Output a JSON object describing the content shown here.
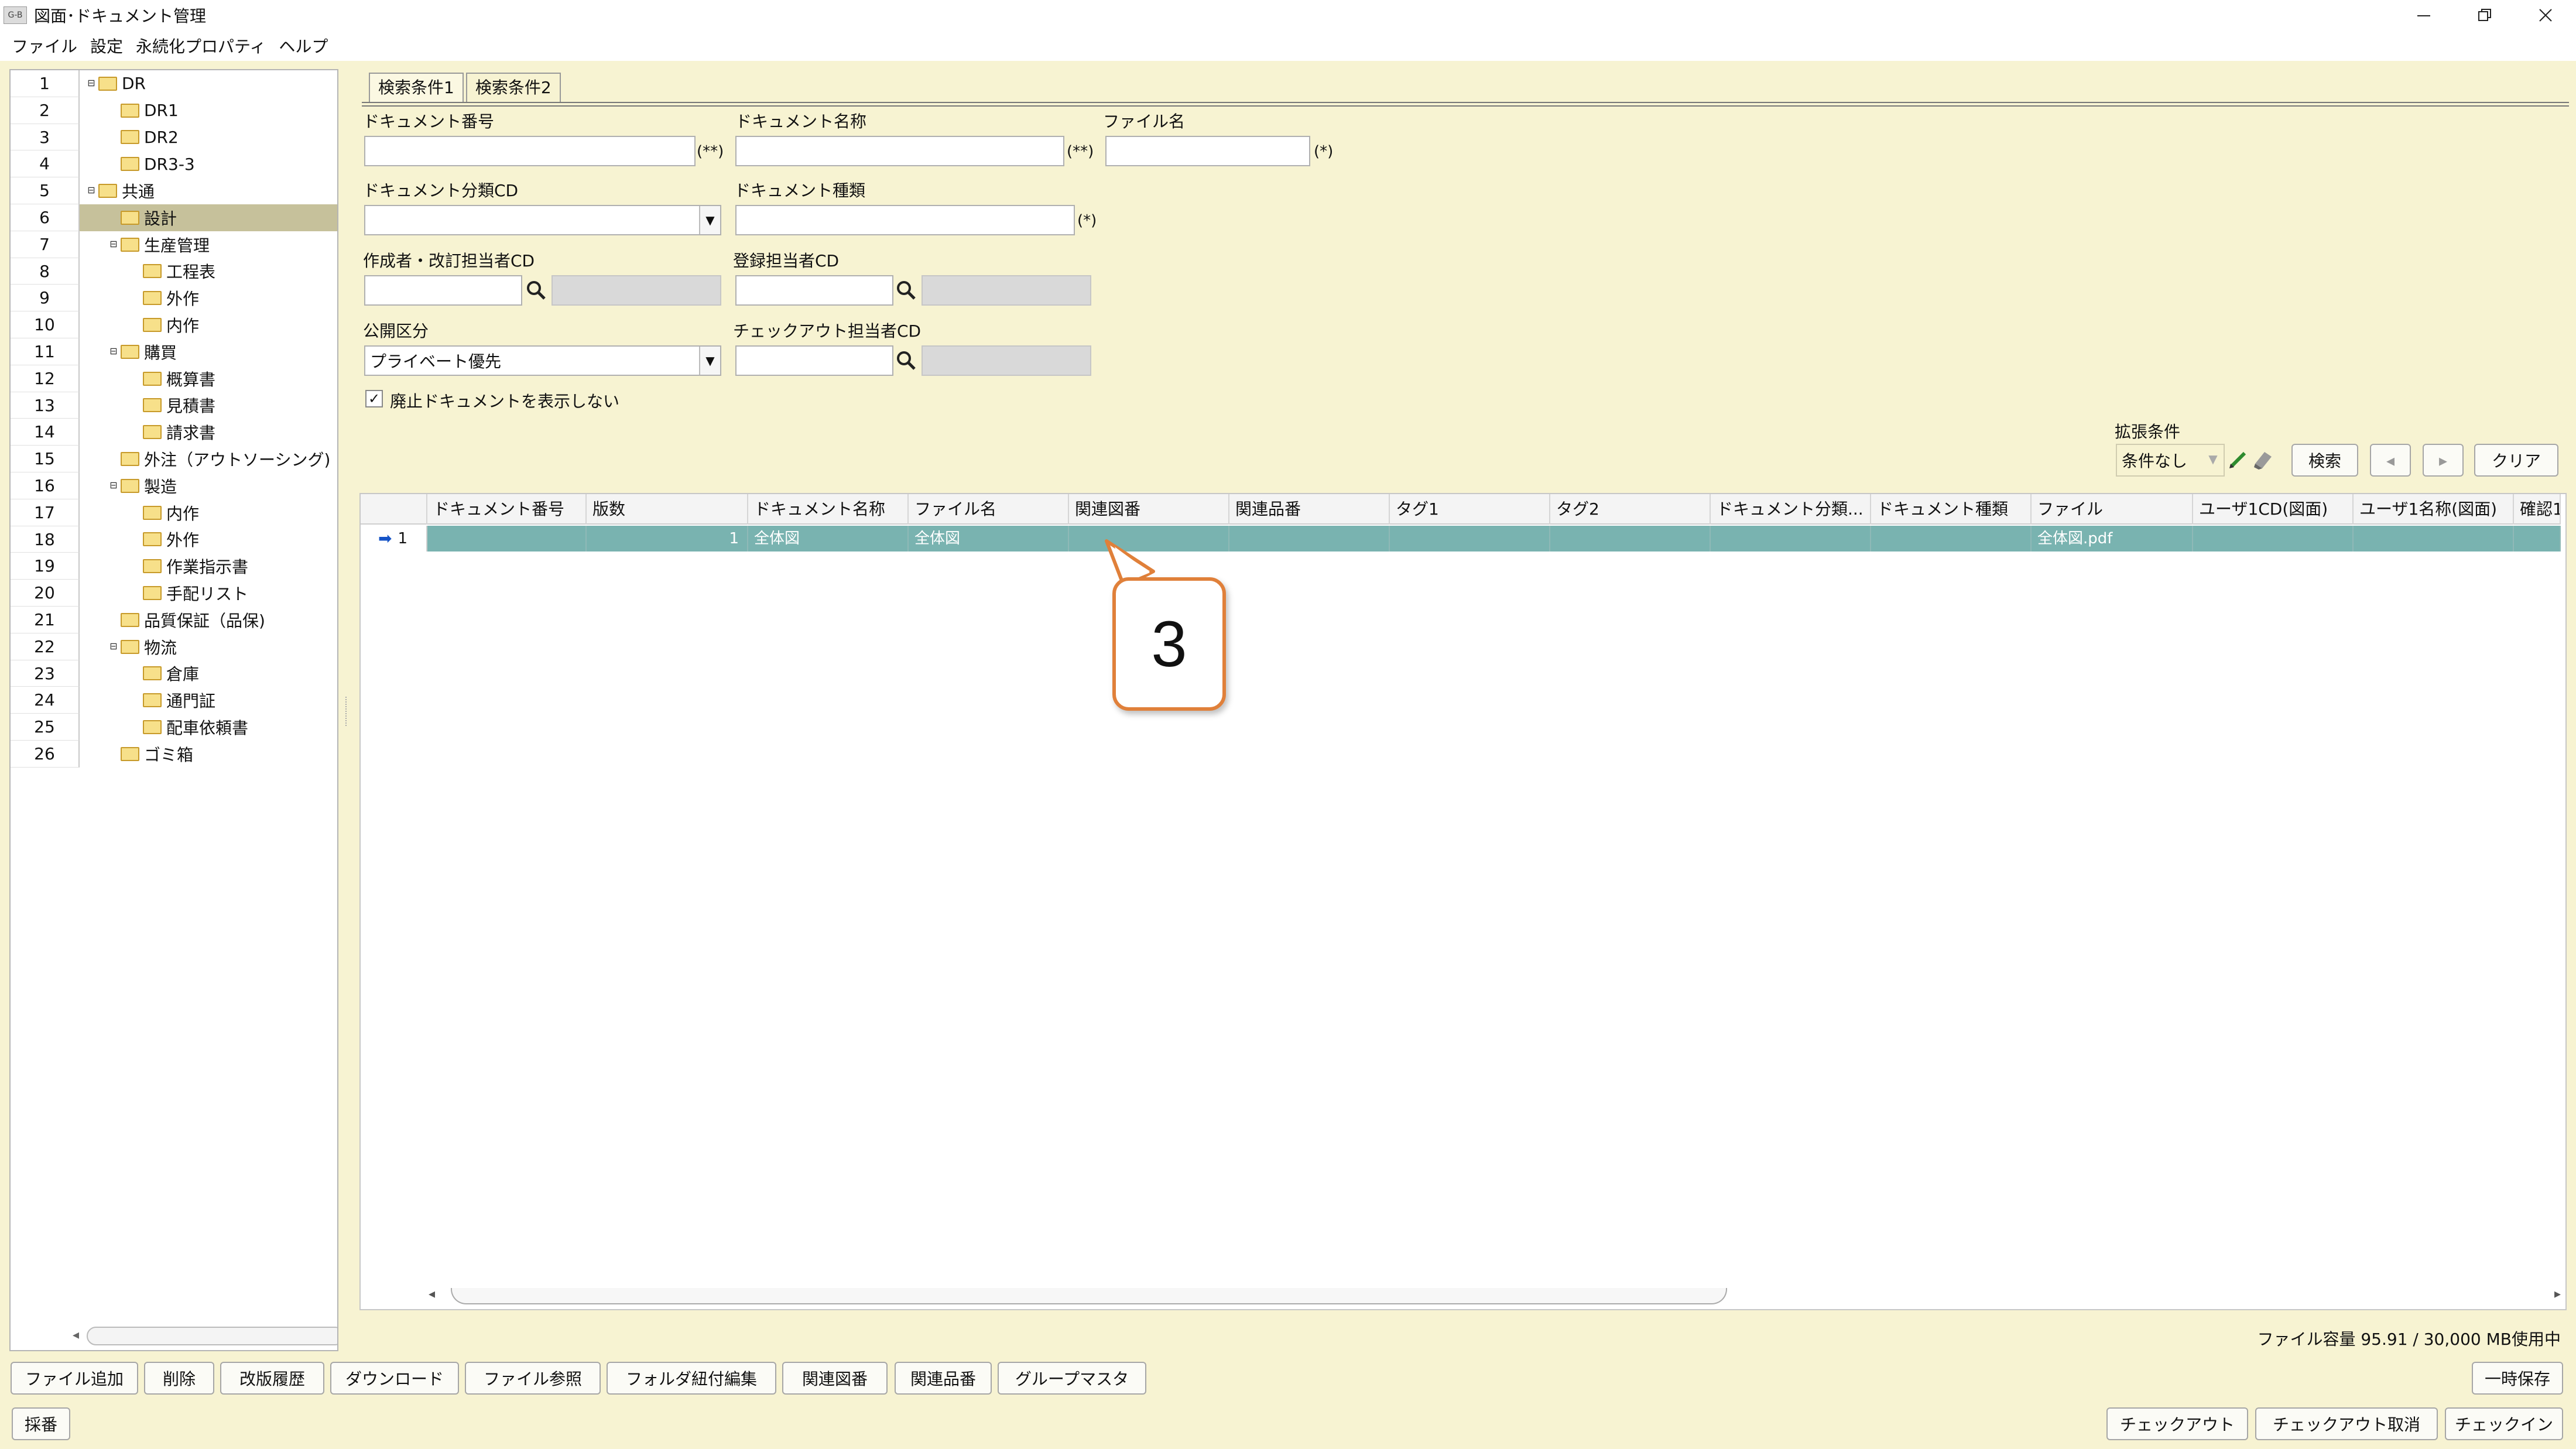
{
  "window": {
    "title": "図面･ドキュメント管理",
    "icon_text": "G-B",
    "controls": [
      "minimize",
      "restore",
      "close"
    ]
  },
  "menu": [
    "ファイル",
    "設定",
    "永続化プロパティ",
    "ヘルプ"
  ],
  "tree": {
    "rows": [
      {
        "num": "1",
        "label": "DR"
      },
      {
        "num": "2",
        "label": "DR1"
      },
      {
        "num": "3",
        "label": "DR2"
      },
      {
        "num": "4",
        "label": "DR3-3"
      },
      {
        "num": "5",
        "label": "共通"
      },
      {
        "num": "6",
        "label": "設計",
        "selected": true
      },
      {
        "num": "7",
        "label": "生産管理"
      },
      {
        "num": "8",
        "label": "工程表"
      },
      {
        "num": "9",
        "label": "外作"
      },
      {
        "num": "10",
        "label": "内作"
      },
      {
        "num": "11",
        "label": "購買"
      },
      {
        "num": "12",
        "label": "概算書"
      },
      {
        "num": "13",
        "label": "見積書"
      },
      {
        "num": "14",
        "label": "請求書"
      },
      {
        "num": "15",
        "label": "外注（アウトソーシング)"
      },
      {
        "num": "16",
        "label": "製造"
      },
      {
        "num": "17",
        "label": "内作"
      },
      {
        "num": "18",
        "label": "外作"
      },
      {
        "num": "19",
        "label": "作業指示書"
      },
      {
        "num": "20",
        "label": "手配リスト"
      },
      {
        "num": "21",
        "label": "品質保証（品保)"
      },
      {
        "num": "22",
        "label": "物流"
      },
      {
        "num": "23",
        "label": "倉庫"
      },
      {
        "num": "24",
        "label": "通門証"
      },
      {
        "num": "25",
        "label": "配車依頼書"
      },
      {
        "num": "26",
        "label": "ゴミ箱"
      }
    ]
  },
  "tabs": [
    "検索条件1",
    "検索条件2"
  ],
  "form": {
    "doc_number_label": "ドキュメント番号",
    "doc_name_label": "ドキュメント名称",
    "file_name_label": "ファイル名",
    "doc_category_label": "ドキュメント分類CD",
    "doc_type_label": "ドキュメント種類",
    "author_label": "作成者・改訂担当者CD",
    "registrant_label": "登録担当者CD",
    "publish_label": "公開区分",
    "publish_value": "プライベート優先",
    "checkout_user_label": "チェックアウト担当者CD",
    "hide_obsolete_label": "廃止ドキュメントを表示しない",
    "hint_double": "(**)",
    "hint_single": "(*)",
    "ext_label": "拡張条件",
    "ext_value": "条件なし",
    "search_btn": "検索",
    "prev_btn": "◂",
    "next_btn": "▸",
    "clear_btn": "クリア"
  },
  "grid": {
    "columns": [
      "ドキュメント番号",
      "版数",
      "ドキュメント名称",
      "ファイル名",
      "関連図番",
      "関連品番",
      "タグ1",
      "タグ2",
      "ドキュメント分類...",
      "ドキュメント種類",
      "ファイル",
      "ユーザ1CD(図面)",
      "ユーザ1名称(図面)",
      "確認1"
    ],
    "rows": [
      {
        "num": "1",
        "cells": [
          "",
          "1",
          "全体図",
          "全体図",
          "",
          "",
          "",
          "",
          "",
          "",
          "全体図.pdf",
          "",
          "",
          ""
        ]
      }
    ]
  },
  "callout": "3",
  "capacity": "ファイル容量 95.91 / 30,000 MB使用中",
  "buttons": {
    "bottom1": [
      "ファイル追加",
      "削除",
      "改版履歴",
      "ダウンロード",
      "ファイル参照",
      "フォルダ紐付編集",
      "関連図番",
      "関連品番",
      "グループマスタ"
    ],
    "temp_save": "一時保存",
    "assign": "採番",
    "checkout": "チェックアウト",
    "checkout_cancel": "チェックアウト取消",
    "checkin": "チェックイン"
  },
  "colors": {
    "background": "#f7f3d2",
    "selected_row": "#79b3b0",
    "tree_selected": "#c6c19b",
    "callout_border": "#e0803a"
  }
}
